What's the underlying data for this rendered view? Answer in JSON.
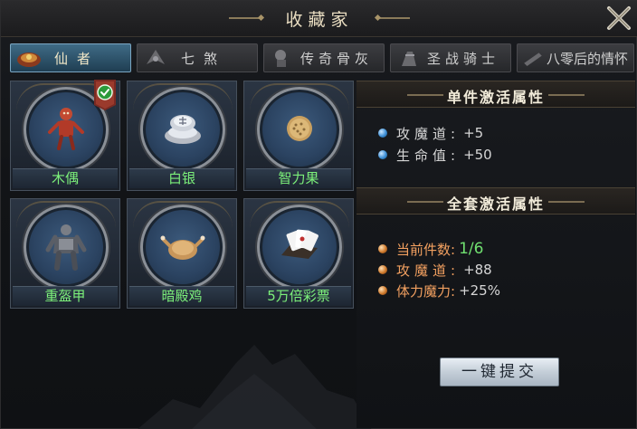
{
  "window": {
    "title": "收藏家"
  },
  "tabs": [
    {
      "label": "仙者",
      "icon": "immortal-tab-icon",
      "active": true
    },
    {
      "label": "七煞",
      "icon": "seven-demons-tab-icon",
      "active": false
    },
    {
      "label": "传奇骨灰",
      "icon": "legend-ashes-tab-icon",
      "active": false
    },
    {
      "label": "圣战骑士",
      "icon": "crusader-knight-tab-icon",
      "active": false
    },
    {
      "label": "八零后的情怀",
      "icon": "post80s-nostalgia-tab-icon",
      "active": false
    }
  ],
  "items": [
    {
      "label": "木偶",
      "icon": "puppet-icon",
      "collected": true
    },
    {
      "label": "白银",
      "icon": "silver-ingot-icon",
      "collected": false
    },
    {
      "label": "智力果",
      "icon": "wisdom-fruit-icon",
      "collected": false
    },
    {
      "label": "重盔甲",
      "icon": "heavy-armor-icon",
      "collected": false
    },
    {
      "label": "暗殿鸡",
      "icon": "dark-hall-chicken-icon",
      "collected": false
    },
    {
      "label": "5万倍彩票",
      "icon": "lottery-ticket-icon",
      "collected": false
    }
  ],
  "single_set": {
    "title": "单件激活属性",
    "attrs": [
      {
        "key": "攻魔道:",
        "value": "+5"
      },
      {
        "key": "生命值:",
        "value": "+50"
      }
    ]
  },
  "full_set": {
    "title": "全套激活属性",
    "progress_label": "当前件数:",
    "progress_value": "1/6",
    "attrs": [
      {
        "key": "攻魔道:",
        "value": "+88"
      },
      {
        "key": "体力魔力:",
        "value": "+25%"
      }
    ]
  },
  "submit_label": "一键提交",
  "colors": {
    "item_label": "#7cf07a",
    "progress_green": "#70e070",
    "orange_key": "#f2a060",
    "active_tab": "#3f6b86"
  }
}
